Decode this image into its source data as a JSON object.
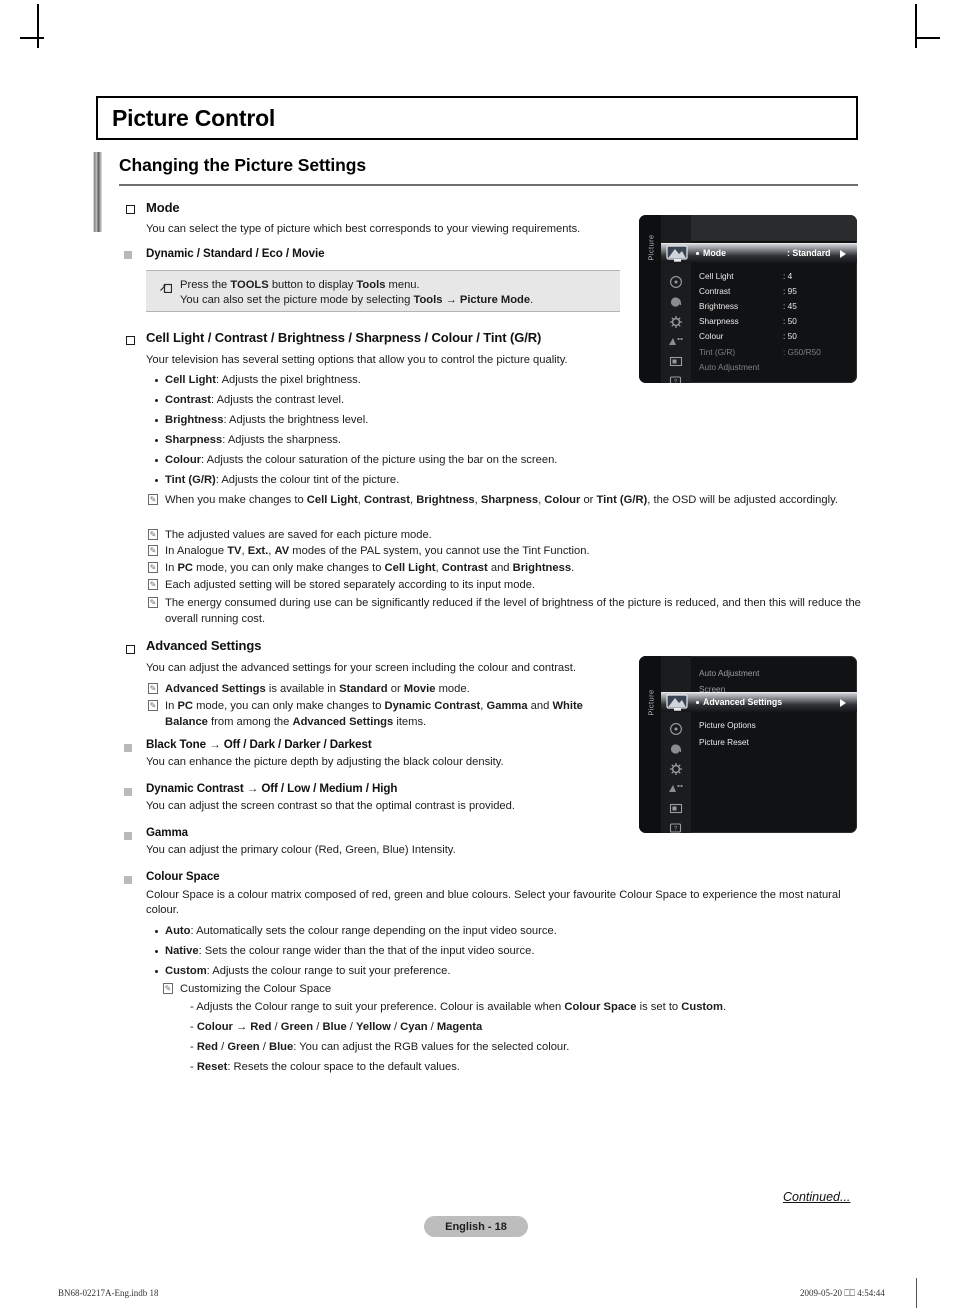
{
  "document": {
    "chapter_title": "Picture Control",
    "section_title": "Changing the Picture Settings"
  },
  "topics": {
    "mode": {
      "heading": "Mode",
      "intro": "You can select the type of picture which best corresponds to your viewing requirements.",
      "options_line": "Dynamic / Standard / Eco / Movie",
      "tools_note_line1_a": "Press the ",
      "tools_note_line1_b": "TOOLS",
      "tools_note_line1_c": " button to display ",
      "tools_note_line1_d": "Tools",
      "tools_note_line1_e": " menu.",
      "tools_note_line2_a": "You can also set the picture mode by selecting ",
      "tools_note_line2_b": "Tools",
      "tools_note_line2_c": " → ",
      "tools_note_line2_d": "Picture Mode",
      "tools_note_line2_e": "."
    },
    "picture_controls": {
      "heading": "Cell Light / Contrast / Brightness / Sharpness / Colour / Tint (G/R)",
      "intro": "Your television has several setting options that allow you to control the picture quality.",
      "bullets": [
        {
          "term": "Cell Light",
          "desc": ": Adjusts the pixel brightness."
        },
        {
          "term": "Contrast",
          "desc": ": Adjusts the contrast level."
        },
        {
          "term": "Brightness",
          "desc": ": Adjusts the brightness level."
        },
        {
          "term": "Sharpness",
          "desc": ": Adjusts the sharpness."
        },
        {
          "term": "Colour",
          "desc": ": Adjusts the colour saturation of the picture using the bar on the screen."
        },
        {
          "term": "Tint (G/R)",
          "desc": ": Adjusts the colour tint of the picture."
        }
      ],
      "notes": [
        "When you make changes to <b>Cell Light</b>, <b>Contrast</b>, <b>Brightness</b>, <b>Sharpness</b>, <b>Colour</b> or <b>Tint (G/R)</b>, the OSD will be adjusted accordingly.",
        "The adjusted values are saved for each picture mode.",
        "In Analogue <b>TV</b>, <b>Ext.</b>, <b>AV</b> modes of the PAL system, you cannot use the Tint Function.",
        "In <b>PC</b> mode, you can only make changes to <b>Cell Light</b>, <b>Contrast</b> and <b>Brightness</b>.",
        "Each adjusted setting will be stored separately according to its input mode.",
        "The energy consumed during use can be significantly reduced if the level of brightness of the picture is reduced, and then this will reduce the overall running cost."
      ]
    },
    "advanced_settings": {
      "heading": "Advanced Settings",
      "intro": "You can adjust the advanced settings for your screen including the colour and contrast.",
      "notes": [
        "<b>Advanced Settings</b> is available in <b>Standard</b> or <b>Movie</b> mode.",
        "In <b>PC</b> mode, you can only make changes to <b>Dynamic Contrast</b>, <b>Gamma</b> and <b>White Balance</b> from among the <b>Advanced Settings</b> items."
      ],
      "sub_items": [
        {
          "heading": "Black Tone → Off / Dark / Darker / Darkest",
          "desc": "You can enhance the picture depth by adjusting the black colour density."
        },
        {
          "heading": "Dynamic Contrast → Off / Low / Medium / High",
          "desc": "You can adjust the screen contrast so that the optimal contrast is provided."
        },
        {
          "heading": "Gamma",
          "desc": "You can adjust the primary colour (Red, Green, Blue) Intensity."
        }
      ],
      "colour_space": {
        "heading": "Colour Space",
        "desc": "Colour Space is a colour matrix composed of red, green and blue colours. Select your favourite Colour Space to experience the most natural colour.",
        "bullets": [
          {
            "term": "Auto",
            "desc": ": Automatically sets the colour range depending on the input video source."
          },
          {
            "term": "Native",
            "desc": ": Sets the colour range wider than the that of the input video source."
          },
          {
            "term": "Custom",
            "desc": ": Adjusts the colour range to suit your preference."
          }
        ],
        "custom_note_heading": "Customizing the Colour Space",
        "custom_note_items": [
          "- Adjusts the Colour range to suit your preference. Colour is available when <b>Colour Space</b> is set to <b>Custom</b>.",
          "- <b>Colour → Red</b> / <b>Green</b> / <b>Blue</b> / <b>Yellow</b> / <b>Cyan</b> / <b>Magenta</b>",
          "- <b>Red</b> / <b>Green</b> / <b>Blue</b>: You can adjust the RGB values for the selected colour.",
          "- <b>Reset</b>: Resets the colour space to the default values."
        ]
      }
    }
  },
  "osd_picture_menu": {
    "rail_label": "Picture",
    "highlight": {
      "label": "Mode",
      "value": ": Standard",
      "arrow": "▶"
    },
    "rows": [
      {
        "label": "Cell Light",
        "value": ": 4",
        "dim": false
      },
      {
        "label": "Contrast",
        "value": ": 95",
        "dim": false
      },
      {
        "label": "Brightness",
        "value": ": 45",
        "dim": false
      },
      {
        "label": "Sharpness",
        "value": ": 50",
        "dim": false
      },
      {
        "label": "Colour",
        "value": ": 50",
        "dim": false
      },
      {
        "label": "Tint (G/R)",
        "value": ": G50/R50",
        "dim": true
      },
      {
        "label": "Auto Adjustment",
        "value": "",
        "dim": true
      }
    ]
  },
  "osd_advanced_menu": {
    "rail_label": "Picture",
    "above_rows": [
      {
        "label": "Auto Adjustment",
        "value": ""
      },
      {
        "label": "Screen",
        "value": ""
      }
    ],
    "highlight": {
      "label": "Advanced Settings",
      "value": "",
      "arrow": "▶"
    },
    "rows": [
      {
        "label": "Picture Options",
        "value": "",
        "dim": false
      },
      {
        "label": "Picture Reset",
        "value": "",
        "dim": false
      }
    ]
  },
  "footer": {
    "continued": "Continued...",
    "page_label": "English - 18",
    "print_file": "BN68-02217A-Eng.indb   18",
    "print_stamp": "2009-05-20   ⎕⎕ 4:54:44"
  }
}
